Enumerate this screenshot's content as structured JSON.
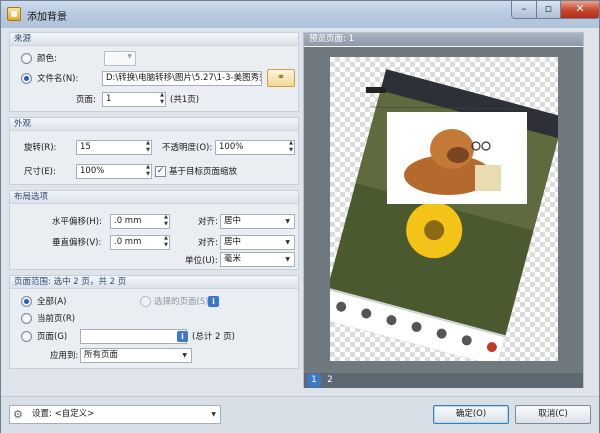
{
  "window": {
    "title": "添加背景"
  },
  "source": {
    "header": "来源",
    "color_label": "颜色:",
    "file_label": "文件名(N):",
    "file_path": "D:\\转换\\电脑转移\\图片\\5.27\\1-3-美图秀秀",
    "page_label": "页面:",
    "page_value": "1",
    "page_total": "(共1页)"
  },
  "appearance": {
    "header": "外观",
    "rotation_label": "旋转(R):",
    "rotation_value": "15",
    "opacity_label": "不透明度(O):",
    "opacity_value": "100%",
    "size_label": "尺寸(E):",
    "size_value": "100%",
    "scale_checkbox_label": "基于目标页面缩放",
    "scale_checked": true
  },
  "layout": {
    "header": "布局选项",
    "h_offset_label": "水平偏移(H):",
    "h_offset_value": ".0 mm",
    "v_offset_label": "垂直偏移(V):",
    "v_offset_value": ".0 mm",
    "align_label": "对齐:",
    "h_align_value": "居中",
    "v_align_value": "居中",
    "unit_label": "单位(U):",
    "unit_value": "毫米"
  },
  "page_range": {
    "header": "页面范围: 选中 2 页，共 2 页",
    "all_label": "全部(A)",
    "selected_label": "选择的页面(S)",
    "current_label": "当前页(R)",
    "pages_label": "页面(G)",
    "pages_value": "",
    "pages_total": "(总计 2 页)",
    "apply_to_label": "应用到:",
    "apply_to_value": "所有页面"
  },
  "preview": {
    "header": "预览页面: 1",
    "pages": [
      "1",
      "2"
    ],
    "current_page": "1"
  },
  "footer": {
    "settings_label": "设置: <自定义>",
    "ok_label": "确定(O)",
    "cancel_label": "取消(C)"
  }
}
